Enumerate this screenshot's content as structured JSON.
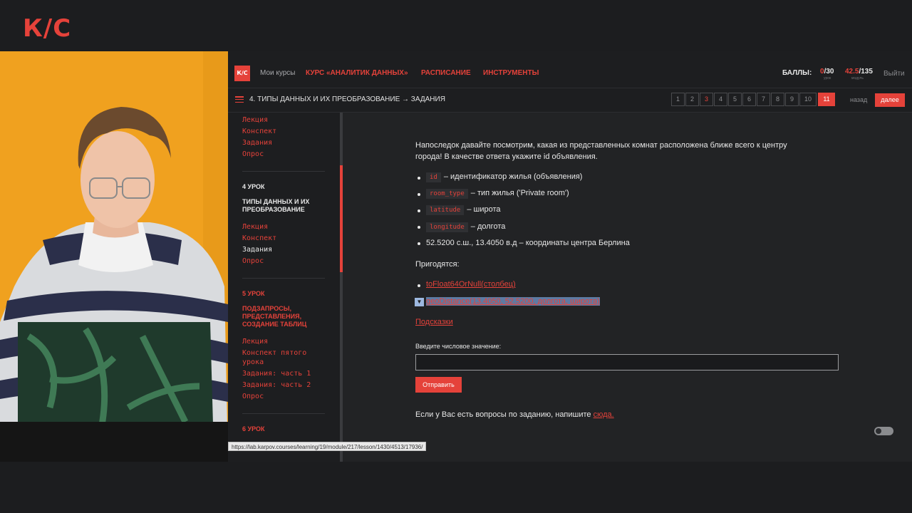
{
  "brand": {
    "logo_text": "К/С"
  },
  "topnav": {
    "logo_text": "К/С",
    "my_courses": "Мои курсы",
    "course": "КУРС «АНАЛИТИК ДАННЫХ»",
    "schedule": "РАСПИСАНИЕ",
    "tools": "ИНСТРУМЕНТЫ",
    "score_label": "БАЛЛЫ:",
    "lesson_score": "0",
    "lesson_total": "/30",
    "lesson_sub": "урок",
    "module_score": "42.5",
    "module_total": "/135",
    "module_sub": "модуль",
    "logout": "Выйти"
  },
  "subbar": {
    "breadcrumb": "4. ТИПЫ ДАННЫХ И ИХ ПРЕОБРАЗОВАНИЕ → ЗАДАНИЯ",
    "pages": [
      "1",
      "2",
      "3",
      "4",
      "5",
      "6",
      "7",
      "8",
      "9",
      "10",
      "11"
    ],
    "back": "назад",
    "next": "далее"
  },
  "sidebar": {
    "l3_items": [
      "Лекция",
      "Конспект",
      "Задания",
      "Опрос"
    ],
    "l4_number": "4 УРОК",
    "l4_title": "ТИПЫ ДАННЫХ И ИХ ПРЕОБРАЗОВАНИЕ",
    "l4_items": [
      "Лекция",
      "Конспект",
      "Задания",
      "Опрос"
    ],
    "l5_number": "5 УРОК",
    "l5_title": "ПОДЗАПРОСЫ, ПРЕДСТАВЛЕНИЯ, СОЗДАНИЕ ТАБЛИЦ",
    "l5_items": [
      "Лекция",
      "Конспект пятого",
      "урока",
      "Задания: часть 1",
      "Задания: часть 2",
      "Опрос"
    ],
    "l6_number": "6 УРОК"
  },
  "task": {
    "intro_line1": "Напоследок давайте посмотрим, какая из представленных комнат расположена ближе всего к центру",
    "intro_line2": "города! В качестве ответа укажите id объявления.",
    "fields": [
      {
        "code": "id",
        "desc": "– идентификатор жилья (объявления)"
      },
      {
        "code": "room_type",
        "desc": "– тип жилья ('Private room')"
      },
      {
        "code": "latitude",
        "desc": "– широта"
      },
      {
        "code": "longitude",
        "desc": "– долгота"
      }
    ],
    "coords": "52.5200 с.ш., 13.4050 в.д – координаты центра Берлина",
    "useful": "Пригодятся:",
    "func1": "toFloat64OrNull(столбец)",
    "func2": "geoDistance(13.4050, 52.5200, долгота, широта)",
    "hints": "Подсказки",
    "input_label": "Введите числовое значение:",
    "input_value": "",
    "submit": "Отправить",
    "footer_text": "Если у Вас есть вопросы по заданию, напишите ",
    "footer_link": "сюда."
  },
  "status_url": "https://lab.karpov.courses/learning/19/module/217/lesson/1430/4513/17936/",
  "colors": {
    "accent": "#e5423a",
    "background": "#222325",
    "webcam_bg": "#f0a11f"
  }
}
